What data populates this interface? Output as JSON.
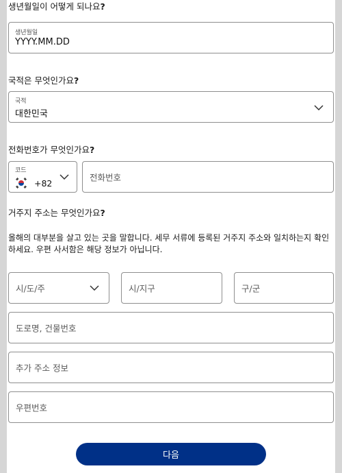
{
  "birthdate": {
    "question": "생년월일이 어떻게 되나요",
    "field_label": "생년월일",
    "value": "YYYY.MM.DD"
  },
  "nationality": {
    "question": "국적은 무엇인가요",
    "field_label": "국적",
    "value": "대한민국"
  },
  "phone": {
    "question": "전화번호가 무엇인가요",
    "code_label": "코드",
    "dial_code": "+82",
    "placeholder": "전화번호"
  },
  "address": {
    "question": "거주지 주소는 무엇인가요",
    "description": "올해의 대부분을 살고 있는 곳을 말합니다. 세무 서류에 등록된 거주지 주소와 일치하는지 확인하세요. 우편 사서함은 해당 정보가 아닙니다.",
    "province_placeholder": "시/도/주",
    "city_placeholder": "시/지구",
    "district_placeholder": "구/군",
    "street_placeholder": "도로명, 건물번호",
    "extra_placeholder": "추가 주소 정보",
    "postal_placeholder": "우편번호"
  },
  "question_mark": "?",
  "next_button": "다음",
  "colors": {
    "primary": "#003087",
    "border": "#8e8e8e",
    "page_bg": "#d6d6d6"
  },
  "icons": {
    "dropdown": "chevron-down-icon",
    "country_flag": "korea-flag-icon"
  }
}
